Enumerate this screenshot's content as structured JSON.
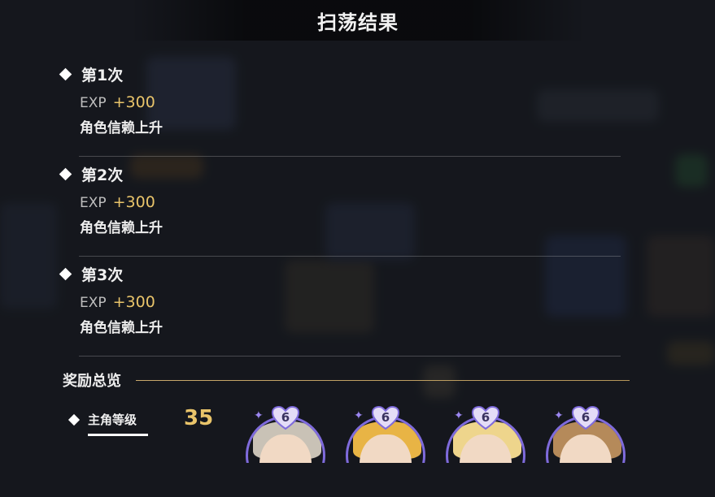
{
  "header": {
    "title": "扫荡结果"
  },
  "rounds": [
    {
      "label": "第1次",
      "exp_label": "EXP",
      "exp_value": "+300",
      "trust": "角色信赖上升"
    },
    {
      "label": "第2次",
      "exp_label": "EXP",
      "exp_value": "+300",
      "trust": "角色信赖上升"
    },
    {
      "label": "第3次",
      "exp_label": "EXP",
      "exp_value": "+300",
      "trust": "角色信赖上升"
    }
  ],
  "summary": {
    "title": "奖励总览",
    "level_label": "主角等级",
    "level_value": "35"
  },
  "characters": [
    {
      "trust_level": "6",
      "hair_color": "#c9c2b6",
      "icon": "heart-icon"
    },
    {
      "trust_level": "6",
      "hair_color": "#e8b445",
      "icon": "heart-icon"
    },
    {
      "trust_level": "6",
      "hair_color": "#eed58c",
      "icon": "heart-icon"
    },
    {
      "trust_level": "6",
      "hair_color": "#b58a5a",
      "icon": "heart-icon"
    }
  ],
  "colors": {
    "accent_gold": "#e9c46a",
    "portrait_ring": "#7f6bdc",
    "background": "#1a1c22"
  }
}
